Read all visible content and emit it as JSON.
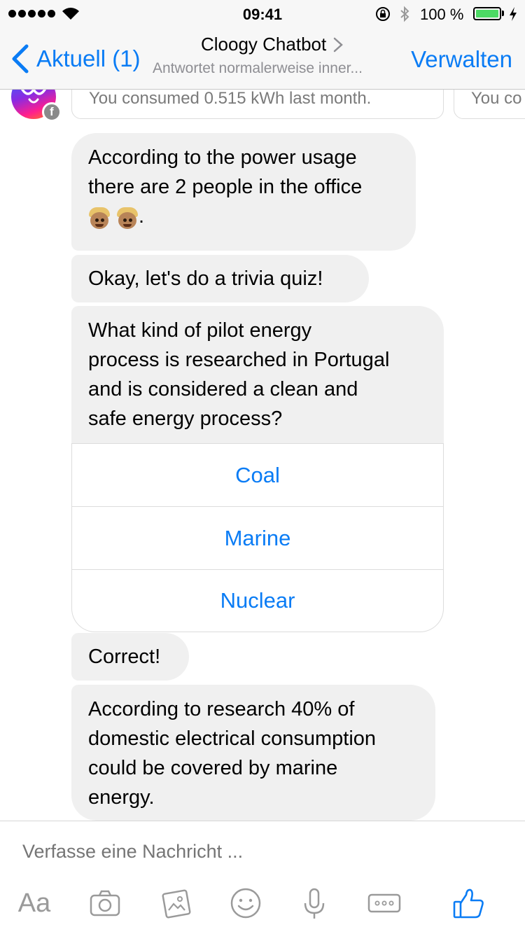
{
  "status_bar": {
    "time": "09:41",
    "battery_percent": "100 %"
  },
  "nav": {
    "back_label": "Aktuell (1)",
    "title": "Cloogy Chatbot",
    "subtitle": "Antwortet normalerweise inner...",
    "manage_label": "Verwalten"
  },
  "chat": {
    "carousel": [
      {
        "text": "You consumed 0.515 kWh last month."
      },
      {
        "text": "You co"
      }
    ],
    "messages": [
      {
        "line1": "According to the power usage",
        "line2": "there are 2 people in the office",
        "suffix": "."
      },
      {
        "text": "Okay, let's do a trivia quiz!"
      },
      {
        "line1": "What kind of pilot energy",
        "line2": "process is researched in Portugal",
        "line3": "and is considered a clean and",
        "line4": "safe energy process?"
      },
      {
        "text": "Correct!"
      },
      {
        "line1": "According to research 40% of",
        "line2": "domestic electrical consumption",
        "line3": "could be covered by marine",
        "line4": "energy."
      }
    ],
    "quiz_options": [
      "Coal",
      "Marine",
      "Nuclear"
    ]
  },
  "composer": {
    "placeholder": "Verfasse eine Nachricht ...",
    "text_button": "Aa"
  },
  "colors": {
    "accent": "#0a7cf5",
    "bubble": "#f0f0f0",
    "battery": "#4cd964"
  }
}
